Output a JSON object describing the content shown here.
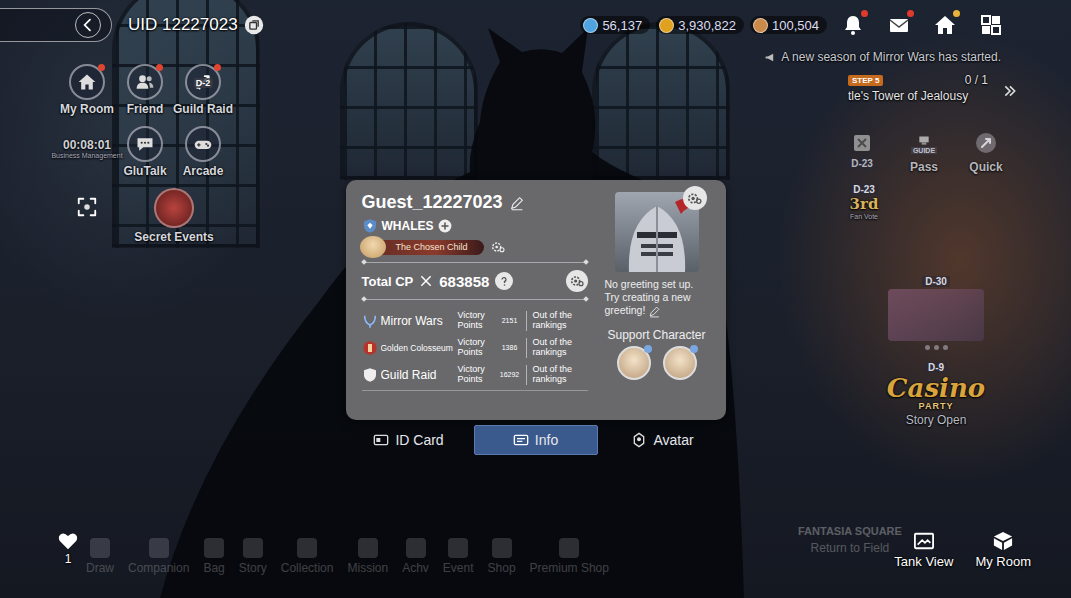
{
  "header": {
    "uid": "UID 12227023"
  },
  "currencies": [
    {
      "value": "56,137",
      "color": "#4fa3e0"
    },
    {
      "value": "3,930,822",
      "color": "#e0a020"
    },
    {
      "value": "100,504",
      "color": "#c98a4a"
    }
  ],
  "top_icons": [
    {
      "kind": "bell",
      "badge": true
    },
    {
      "kind": "mail",
      "badge": true
    },
    {
      "kind": "home",
      "badge": true
    },
    {
      "kind": "grid",
      "badge": false
    }
  ],
  "notice": "A new season of Mirror Wars has started.",
  "quest": {
    "step": "STEP 5",
    "progress": "0 / 1",
    "title": "tle's Tower of Jealousy"
  },
  "left_menu": [
    {
      "kind": "room",
      "label": "My Room",
      "badge": true
    },
    {
      "kind": "friend",
      "label": "Friend",
      "badge": true
    },
    {
      "kind": "raid",
      "label": "Guild Raid",
      "tag": "D-2",
      "badge": true
    },
    {
      "kind": "business",
      "label": "Business Management",
      "timer": "00:08:01",
      "badge": false
    },
    {
      "kind": "talk",
      "label": "GluTalk",
      "badge": false
    },
    {
      "kind": "arcade",
      "label": "Arcade",
      "badge": false
    }
  ],
  "secret_events": {
    "label": "Secret Events"
  },
  "right_menu": [
    {
      "kind": "event",
      "tag": "D-23"
    },
    {
      "kind": "guide",
      "icon_text": "GUIDE",
      "label": "Pass"
    },
    {
      "kind": "quick",
      "label": "Quick"
    }
  ],
  "events": [
    {
      "kind": "fanvote",
      "tag": "D-23",
      "title": "3rd",
      "subtitle": "Fan Vote"
    },
    {
      "kind": "banner",
      "tag": "D-30"
    },
    {
      "kind": "casino",
      "tag": "D-9",
      "title": "Casino",
      "subtitle": "PARTY",
      "caption": "Story Open"
    }
  ],
  "profile": {
    "name": "Guest_12227023",
    "guild": "WHALES",
    "title": "The Chosen Child",
    "cp_label": "Total CP",
    "cp": "683858",
    "ranks": [
      {
        "mode": "Mirror Wars",
        "label": "Victory Points",
        "points": "2151",
        "rank": "Out of the rankings"
      },
      {
        "mode": "Golden Colosseum",
        "label": "Victory Points",
        "points": "1386",
        "rank": "Out of the rankings"
      },
      {
        "mode": "Guild Raid",
        "label": "Victory Points",
        "points": "16292",
        "rank": "Out of the rankings"
      }
    ],
    "greeting": "No greeting set up. Try creating a new greeting!",
    "support_label": "Support Character"
  },
  "tabs": [
    {
      "label": "ID Card",
      "selected": false
    },
    {
      "label": "Info",
      "selected": true
    },
    {
      "label": "Avatar",
      "selected": false
    }
  ],
  "likes": "1",
  "bottom_nav": [
    "Draw",
    "Companion",
    "Bag",
    "Story",
    "Collection",
    "Mission",
    "Achv",
    "Event",
    "Shop",
    "Premium Shop"
  ],
  "field": {
    "title": "FANTASIA SQUARE",
    "action": "Return to Field"
  },
  "bottom_buttons": [
    {
      "kind": "tank",
      "label": "Tank View"
    },
    {
      "kind": "room",
      "label": "My Room"
    }
  ]
}
